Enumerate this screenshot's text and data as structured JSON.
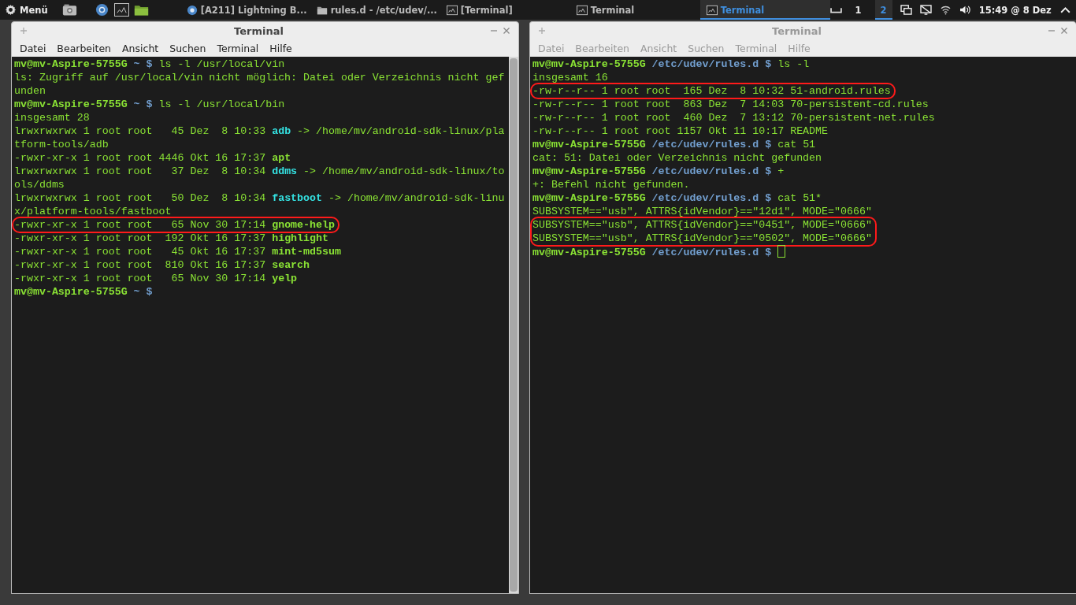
{
  "taskbar": {
    "menu_label": "Menü",
    "launchers": [
      {
        "kind": "camera"
      },
      {
        "kind": "browser"
      },
      {
        "kind": "terminal"
      },
      {
        "kind": "folder"
      }
    ],
    "tasks": [
      {
        "label": "[A211] Lightning B...",
        "kind": "browser",
        "selected": false
      },
      {
        "label": "rules.d - /etc/udev/...",
        "kind": "folder",
        "selected": false
      },
      {
        "label": "[Terminal]",
        "kind": "terminal",
        "selected": false
      },
      {
        "label": "Terminal",
        "kind": "terminal",
        "selected": false
      },
      {
        "label": "Terminal",
        "kind": "terminal",
        "selected": true
      }
    ],
    "workspaces": [
      {
        "label": "1",
        "selected": false
      },
      {
        "label": "2",
        "selected": true
      }
    ],
    "clock": "15:49 @ 8 Dez"
  },
  "windows": [
    {
      "title": "Terminal",
      "active": true,
      "scrollbar": true,
      "cursor": false,
      "menu": [
        "Datei",
        "Bearbeiten",
        "Ansicht",
        "Suchen",
        "Terminal",
        "Hilfe"
      ],
      "lines": [
        {
          "circled": false,
          "segments": [
            {
              "kind": "user",
              "text": "mv@mv-Aspire-5755G"
            },
            {
              "kind": "path",
              "text": " ~ $"
            },
            {
              "kind": "plain",
              "text": " ls -l /usr/local/vin"
            }
          ]
        },
        {
          "circled": false,
          "segments": [
            {
              "kind": "plain",
              "text": "ls: Zugriff auf /usr/local/vin nicht möglich: Datei oder Verzeichnis nicht gef"
            }
          ]
        },
        {
          "circled": false,
          "segments": [
            {
              "kind": "plain",
              "text": "unden"
            }
          ]
        },
        {
          "circled": false,
          "segments": [
            {
              "kind": "user",
              "text": "mv@mv-Aspire-5755G"
            },
            {
              "kind": "path",
              "text": " ~ $"
            },
            {
              "kind": "plain",
              "text": " ls -l /usr/local/bin"
            }
          ]
        },
        {
          "circled": false,
          "segments": [
            {
              "kind": "plain",
              "text": "insgesamt 28"
            }
          ]
        },
        {
          "circled": false,
          "segments": [
            {
              "kind": "plain",
              "text": "lrwxrwxrwx 1 root root   45 Dez  8 10:33 "
            },
            {
              "kind": "link",
              "text": "adb"
            },
            {
              "kind": "plain",
              "text": " -> /home/mv/android-sdk-linux/pla"
            }
          ]
        },
        {
          "circled": false,
          "segments": [
            {
              "kind": "plain",
              "text": "tform-tools/adb"
            }
          ]
        },
        {
          "circled": false,
          "segments": [
            {
              "kind": "plain",
              "text": "-rwxr-xr-x 1 root root 4446 Okt 16 17:37 "
            },
            {
              "kind": "exec",
              "text": "apt"
            }
          ]
        },
        {
          "circled": false,
          "segments": [
            {
              "kind": "plain",
              "text": "lrwxrwxrwx 1 root root   37 Dez  8 10:34 "
            },
            {
              "kind": "link",
              "text": "ddms"
            },
            {
              "kind": "plain",
              "text": " -> /home/mv/android-sdk-linux/to"
            }
          ]
        },
        {
          "circled": false,
          "segments": [
            {
              "kind": "plain",
              "text": "ols/ddms"
            }
          ]
        },
        {
          "circled": false,
          "segments": [
            {
              "kind": "plain",
              "text": "lrwxrwxrwx 1 root root   50 Dez  8 10:34 "
            },
            {
              "kind": "link",
              "text": "fastboot"
            },
            {
              "kind": "plain",
              "text": " -> /home/mv/android-sdk-linu"
            }
          ]
        },
        {
          "circled": false,
          "segments": [
            {
              "kind": "plain",
              "text": "x/platform-tools/fastboot"
            }
          ]
        },
        {
          "circled": true,
          "segments": [
            {
              "kind": "plain",
              "text": "-rwxr-xr-x 1 root root   65 Nov 30 17:14 "
            },
            {
              "kind": "exec",
              "text": "gnome-help"
            }
          ]
        },
        {
          "circled": false,
          "segments": [
            {
              "kind": "plain",
              "text": "-rwxr-xr-x 1 root root  192 Okt 16 17:37 "
            },
            {
              "kind": "exec",
              "text": "highlight"
            }
          ]
        },
        {
          "circled": false,
          "segments": [
            {
              "kind": "plain",
              "text": "-rwxr-xr-x 1 root root   45 Okt 16 17:37 "
            },
            {
              "kind": "exec",
              "text": "mint-md5sum"
            }
          ]
        },
        {
          "circled": false,
          "segments": [
            {
              "kind": "plain",
              "text": "-rwxr-xr-x 1 root root  810 Okt 16 17:37 "
            },
            {
              "kind": "exec",
              "text": "search"
            }
          ]
        },
        {
          "circled": false,
          "segments": [
            {
              "kind": "plain",
              "text": "-rwxr-xr-x 1 root root   65 Nov 30 17:14 "
            },
            {
              "kind": "exec",
              "text": "yelp"
            }
          ]
        },
        {
          "circled": false,
          "segments": [
            {
              "kind": "user",
              "text": "mv@mv-Aspire-5755G"
            },
            {
              "kind": "path",
              "text": " ~ $"
            }
          ]
        }
      ]
    },
    {
      "title": "Terminal",
      "active": false,
      "scrollbar": false,
      "cursor": true,
      "menu": [
        "Datei",
        "Bearbeiten",
        "Ansicht",
        "Suchen",
        "Terminal",
        "Hilfe"
      ],
      "lines": [
        {
          "circled": false,
          "segments": [
            {
              "kind": "user",
              "text": "mv@mv-Aspire-5755G"
            },
            {
              "kind": "path",
              "text": " /etc/udev/rules.d $"
            },
            {
              "kind": "plain",
              "text": " ls -l"
            }
          ]
        },
        {
          "circled": false,
          "segments": [
            {
              "kind": "plain",
              "text": "insgesamt 16"
            }
          ]
        },
        {
          "circled": true,
          "segments": [
            {
              "kind": "plain",
              "text": "-rw-r--r-- 1 root root  165 Dez  8 10:32 51-android.rules"
            }
          ]
        },
        {
          "circled": false,
          "segments": [
            {
              "kind": "plain",
              "text": "-rw-r--r-- 1 root root  863 Dez  7 14:03 70-persistent-cd.rules"
            }
          ]
        },
        {
          "circled": false,
          "segments": [
            {
              "kind": "plain",
              "text": "-rw-r--r-- 1 root root  460 Dez  7 13:12 70-persistent-net.rules"
            }
          ]
        },
        {
          "circled": false,
          "segments": [
            {
              "kind": "plain",
              "text": "-rw-r--r-- 1 root root 1157 Okt 11 10:17 README"
            }
          ]
        },
        {
          "circled": false,
          "segments": [
            {
              "kind": "user",
              "text": "mv@mv-Aspire-5755G"
            },
            {
              "kind": "path",
              "text": " /etc/udev/rules.d $"
            },
            {
              "kind": "plain",
              "text": " cat 51"
            }
          ]
        },
        {
          "circled": false,
          "segments": [
            {
              "kind": "plain",
              "text": "cat: 51: Datei oder Verzeichnis nicht gefunden"
            }
          ]
        },
        {
          "circled": false,
          "segments": [
            {
              "kind": "user",
              "text": "mv@mv-Aspire-5755G"
            },
            {
              "kind": "path",
              "text": " /etc/udev/rules.d $"
            },
            {
              "kind": "plain",
              "text": " +"
            }
          ]
        },
        {
          "circled": false,
          "segments": [
            {
              "kind": "plain",
              "text": "+: Befehl nicht gefunden."
            }
          ]
        },
        {
          "circled": false,
          "segments": [
            {
              "kind": "user",
              "text": "mv@mv-Aspire-5755G"
            },
            {
              "kind": "path",
              "text": " /etc/udev/rules.d $"
            },
            {
              "kind": "plain",
              "text": " cat 51*"
            }
          ]
        },
        {
          "circled": false,
          "segments": [
            {
              "kind": "plain",
              "text": "SUBSYSTEM==\"usb\", ATTRS{idVendor}==\"12d1\", MODE=\"0666\""
            }
          ]
        },
        {
          "circled": true,
          "segments": [
            {
              "kind": "plain",
              "text": "SUBSYSTEM==\"usb\", ATTRS{idVendor}==\"0451\", MODE=\"0666\""
            }
          ]
        },
        {
          "circled": true,
          "segments": [
            {
              "kind": "plain",
              "text": "SUBSYSTEM==\"usb\", ATTRS{idVendor}==\"0502\", MODE=\"0666\""
            }
          ]
        },
        {
          "circled": false,
          "segments": [
            {
              "kind": "user",
              "text": "mv@mv-Aspire-5755G"
            },
            {
              "kind": "path",
              "text": " /etc/udev/rules.d $"
            }
          ]
        }
      ]
    }
  ]
}
